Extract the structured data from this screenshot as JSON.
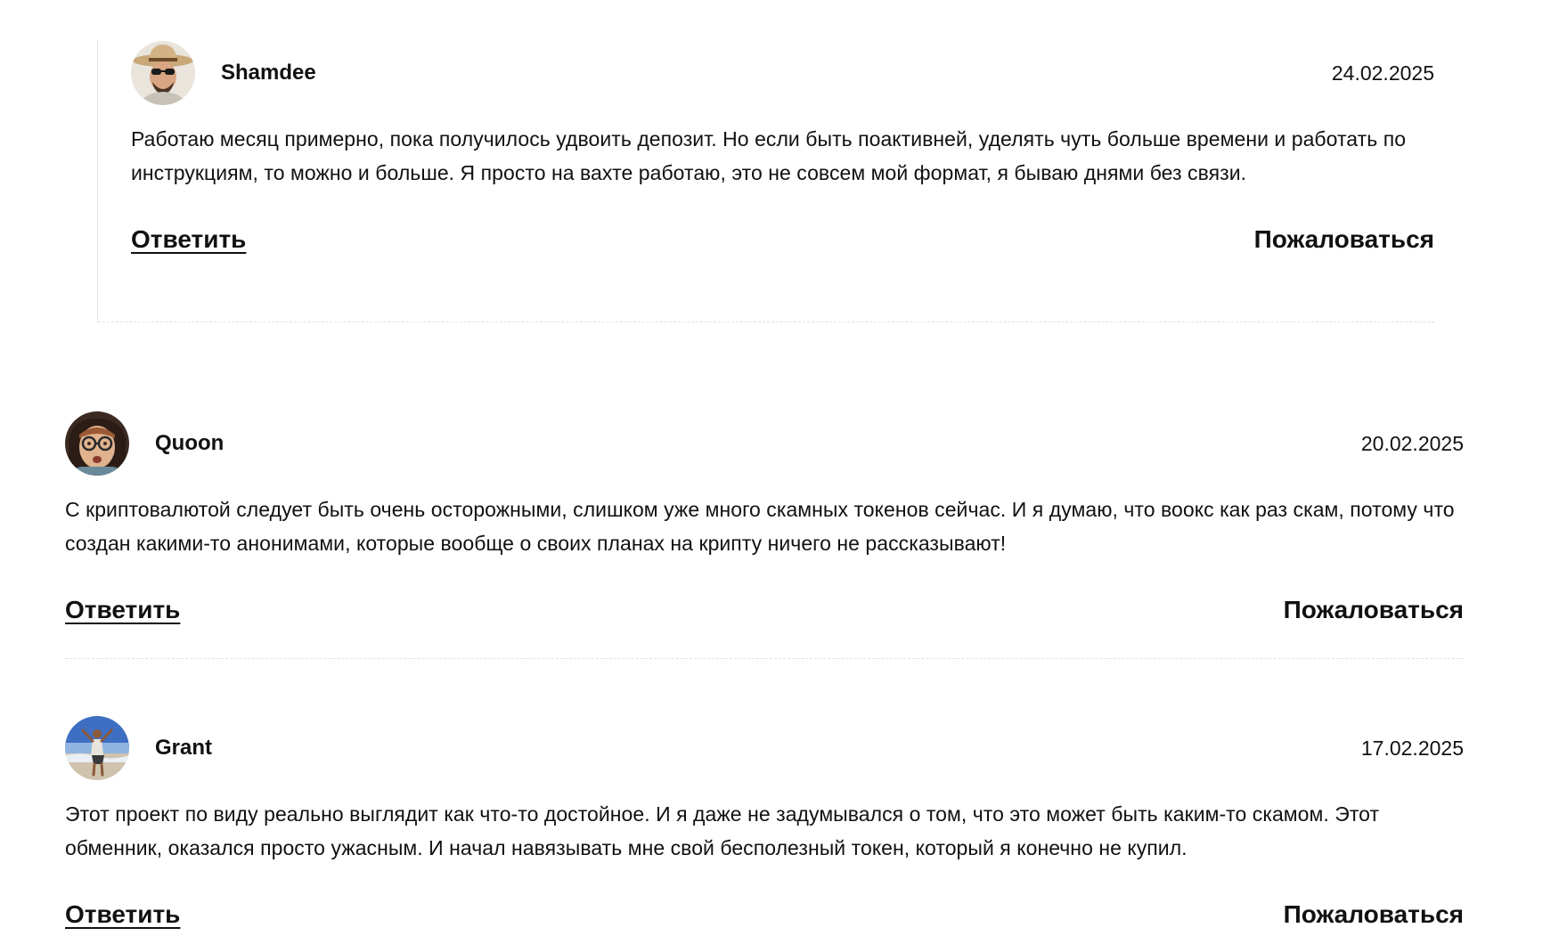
{
  "comments": [
    {
      "author": "Shamdee",
      "date": "24.02.2025",
      "text": "Работаю месяц примерно, пока получилось удвоить депозит. Но если быть поактивней, уделять чуть больше времени и работать по инструкциям, то можно и больше. Я просто на вахте работаю, это не совсем мой формат, я бываю днями без связи.",
      "reply_label": "Ответить",
      "report_label": "Пожаловаться",
      "avatar_icon": "man-with-hat-and-sunglasses-avatar"
    },
    {
      "author": "Quoon",
      "date": "20.02.2025",
      "text": "С криптовалютой следует быть очень осторожными, слишком уже много скамных токенов сейчас. И я думаю, что воокс как раз скам, потому что создан какими-то анонимами, которые вообще о своих планах на крипту ничего не рассказывают!",
      "reply_label": "Ответить",
      "report_label": "Пожаловаться",
      "avatar_icon": "man-with-glasses-avatar"
    },
    {
      "author": "Grant",
      "date": "17.02.2025",
      "text": "Этот проект по виду реально выглядит как что-то достойное. И я даже не задумывался о том, что это может быть каким-то скамом. Этот обменник, оказался просто ужасным. И начал навязывать мне свой бесполезный токен, который я конечно не купил.",
      "reply_label": "Ответить",
      "report_label": "Пожаловаться",
      "avatar_icon": "man-on-beach-avatar"
    }
  ]
}
